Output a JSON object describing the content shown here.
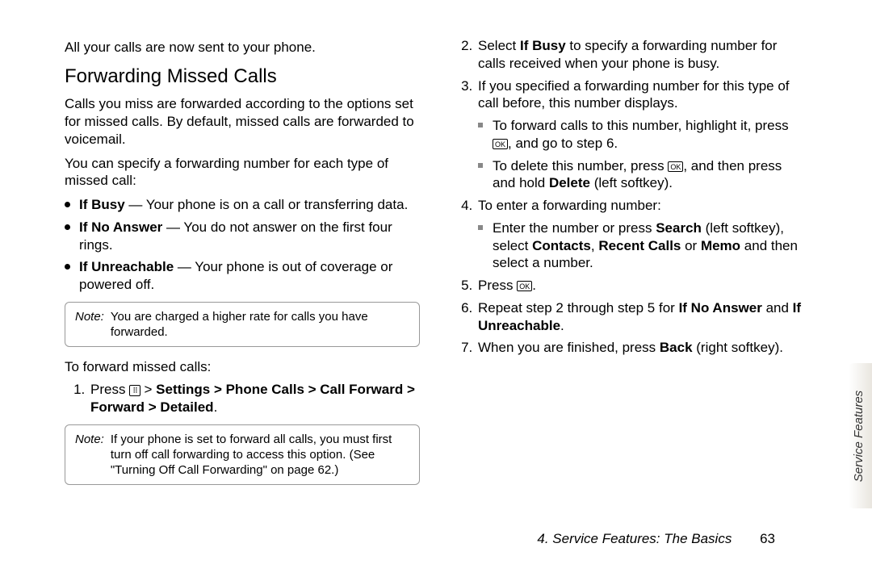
{
  "left": {
    "intro_line": "All your calls are now sent to your phone.",
    "heading": "Forwarding Missed Calls",
    "para1": "Calls you miss are forwarded according to the options set for missed calls. By default, missed calls are forwarded to voicemail.",
    "para2": "You can specify a forwarding number for each type of missed call:",
    "bullets": {
      "b1a": "If Busy",
      "b1b": " — Your phone is on a call or transferring data.",
      "b2a": "If No Answer",
      "b2b": " — You do not answer on the first four rings.",
      "b3a": "If Unreachable",
      "b3b": " — Your phone is out of coverage or powered off."
    },
    "note1_label": "Note:",
    "note1_text": "You are charged a higher rate for calls you have forwarded.",
    "subhead": "To forward missed calls:",
    "step1_a": "Press ",
    "step1_b": " > ",
    "step1_path": "Settings > Phone Calls > Call Forward > Forward  > Detailed",
    "step1_end": ".",
    "note2_label": "Note:",
    "note2_text": "If your phone is set to forward all calls, you must first turn off call forwarding to access this option. (See \"Turning Off Call Forwarding\" on page 62.)"
  },
  "right": {
    "s2": {
      "a": "Select ",
      "b": "If Busy",
      "c": " to specify a forwarding number for calls received when your phone is busy."
    },
    "s3": "If you specified a forwarding number for this type of call before, this number displays.",
    "s3sq1a": "To forward calls to this number, highlight it, press ",
    "s3sq1b": ", and go to step 6.",
    "s3sq2a": "To delete this number, press ",
    "s3sq2b": ", and then press and hold ",
    "s3sq2c": "Delete",
    "s3sq2d": " (left softkey).",
    "s4": "To enter a forwarding number:",
    "s4sq1a": "Enter the number or press ",
    "s4sq1b": "Search",
    "s4sq1c": " (left softkey), select ",
    "s4sq1d": "Contacts",
    "s4sq1e": ", ",
    "s4sq1f": "Recent Calls",
    "s4sq1g": " or ",
    "s4sq1h": "Memo",
    "s4sq1i": " and then select a number.",
    "s5a": "Press ",
    "s5b": ".",
    "s6a": "Repeat step 2 through step 5 for ",
    "s6b": "If No Answer",
    "s6c": " and ",
    "s6d": "If Unreachable",
    "s6e": ".",
    "s7a": "When you are finished, press ",
    "s7b": "Back",
    "s7c": " (right softkey)."
  },
  "icons": {
    "ok": "OK",
    "menu": "⠿"
  },
  "footer": {
    "chapter": "4. Service Features: The Basics",
    "page": "63"
  },
  "sidetab": "Service Features"
}
